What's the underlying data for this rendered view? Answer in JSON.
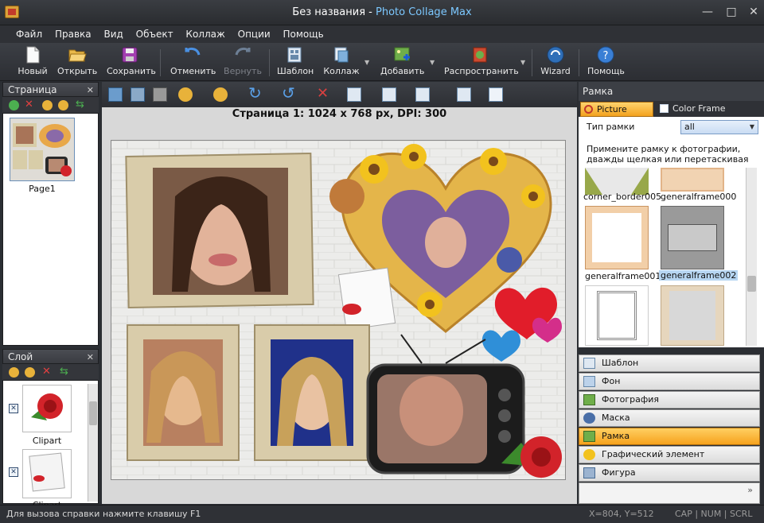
{
  "window": {
    "title_main": "Без названия - ",
    "title_app": "Photo Collage Max",
    "minimize": "—",
    "maximize": "□",
    "close": "✕"
  },
  "menu": [
    "Файл",
    "Правка",
    "Вид",
    "Объект",
    "Коллаж",
    "Опции",
    "Помощь"
  ],
  "toolbar": {
    "new": "Новый",
    "open": "Открыть",
    "save": "Сохранить",
    "undo": "Отменить",
    "redo": "Вернуть",
    "template": "Шаблон",
    "collage": "Коллаж",
    "add": "Добавить",
    "share": "Распространить",
    "wizard": "Wizard",
    "help": "Помощь"
  },
  "page_panel": {
    "title": "Страница",
    "page_label": "Page1"
  },
  "layer_panel": {
    "title": "Слой",
    "items": [
      "Clipart",
      "Clipart"
    ]
  },
  "canvas": {
    "caption": "Страница 1: 1024 x 768 px, DPI: 300"
  },
  "right_panel": {
    "title": "Рамка",
    "tab_picture": "Picture Frame",
    "tab_color": "Color Frame",
    "frame_type_label": "Тип рамки",
    "frame_type_value": "all",
    "hint": "Примените рамку к фотографии, дважды щелкая или перетаскивая",
    "frames": [
      "corner_border005",
      "generalframe000",
      "generalframe001",
      "generalframe002"
    ],
    "accordion": [
      "Шаблон",
      "Фон",
      "Фотография",
      "Маска",
      "Рамка",
      "Графический элемент",
      "Фигура"
    ]
  },
  "status": {
    "help": "Для вызова справки нажмите клавишу F1",
    "coords": "X=804, Y=512",
    "keys": "CAP | NUM | SCRL"
  },
  "colors": {
    "accent_active": "#f6a21d",
    "selection": "#b7d6f2"
  }
}
